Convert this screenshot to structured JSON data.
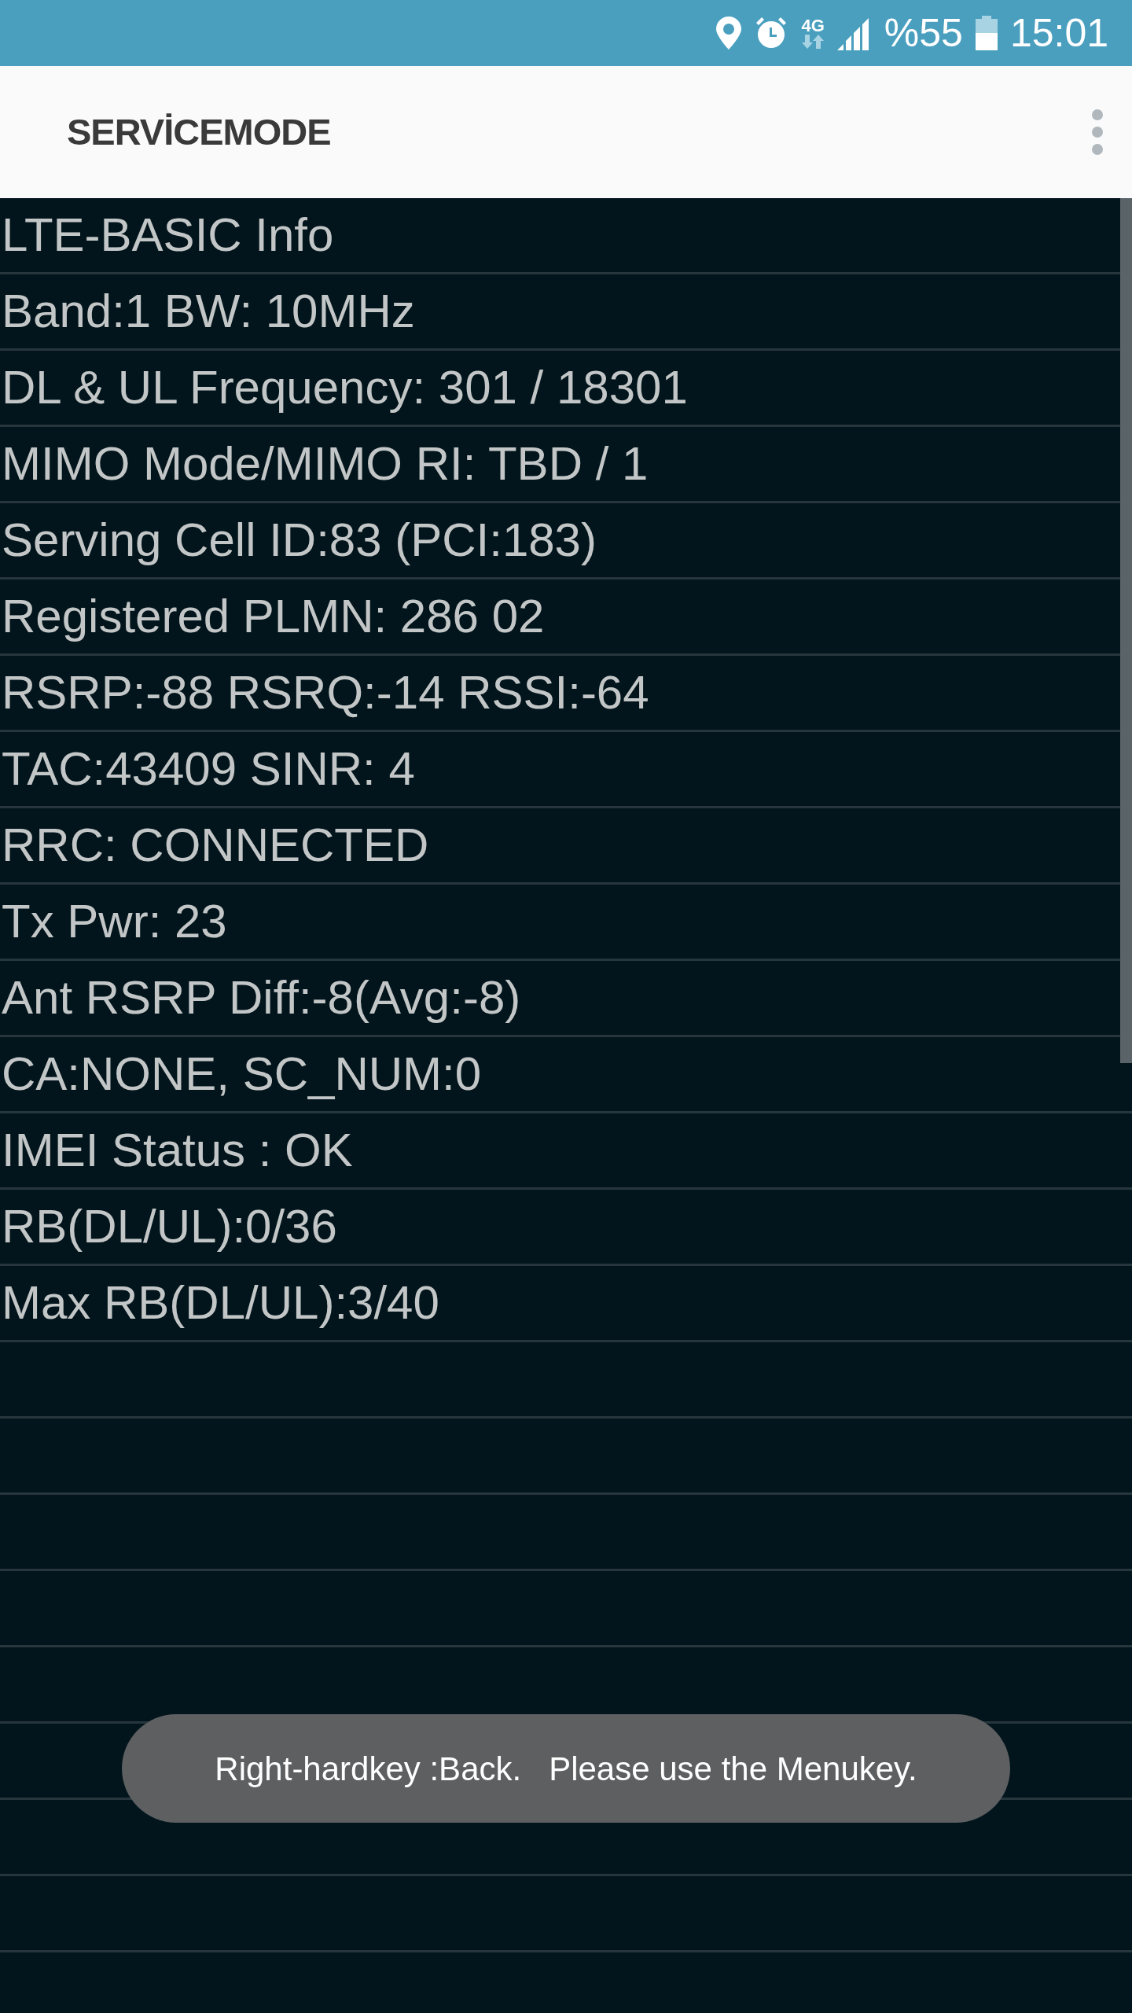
{
  "status_bar": {
    "network_type": "4G",
    "battery_text": "%55",
    "time": "15:01"
  },
  "app_bar": {
    "title": "SERVİCEMODE"
  },
  "info_rows": [
    "LTE-BASIC Info",
    "Band:1 BW: 10MHz",
    "DL & UL Frequency: 301 / 18301",
    "MIMO Mode/MIMO RI: TBD / 1",
    "Serving Cell ID:83 (PCI:183)",
    "Registered PLMN: 286 02",
    "RSRP:-88 RSRQ:-14 RSSI:-64",
    "TAC:43409 SINR: 4",
    "RRC: CONNECTED",
    "Tx Pwr: 23",
    "Ant RSRP Diff:-8(Avg:-8)",
    "CA:NONE, SC_NUM:0",
    "IMEI Status : OK",
    "RB(DL/UL):0/36",
    "Max RB(DL/UL):3/40"
  ],
  "toast": {
    "text": "Right-hardkey :Back.   Please use the Menukey."
  }
}
